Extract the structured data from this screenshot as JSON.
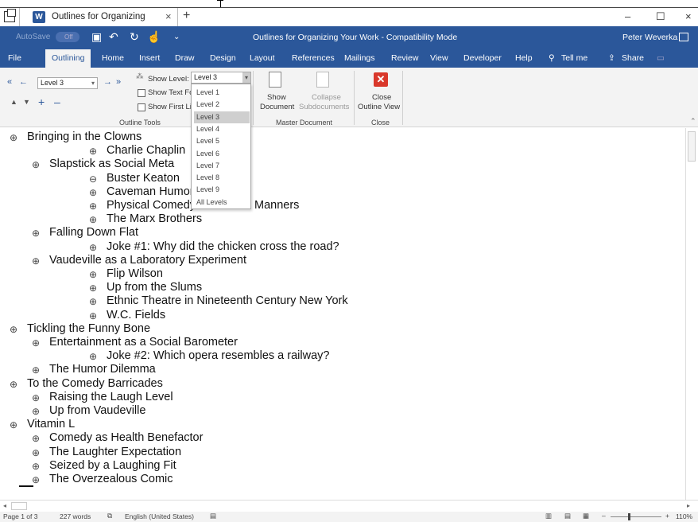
{
  "browser": {
    "tab_title": "Outlines for Organizing",
    "tab_close": "×",
    "new_tab": "+",
    "minimize": "–",
    "maximize": "☐",
    "close": "×"
  },
  "titlebar": {
    "autosave": "AutoSave",
    "autosave_state": "Off",
    "doc_title": "Outlines for Organizing Your Work - Compatibility Mode",
    "user": "Peter Weverka"
  },
  "ribbon_tabs": [
    "File",
    "Outlining",
    "Home",
    "Insert",
    "Draw",
    "Design",
    "Layout",
    "References",
    "Mailings",
    "Review",
    "View",
    "Developer",
    "Help",
    "Tell me",
    "Share"
  ],
  "ribbon": {
    "level_combo": "Level 3",
    "show_level_label": "Show Level:",
    "show_level_value": "Level 3",
    "show_text_formatting": "Show Text Fo",
    "show_first_line": "Show First Li",
    "outline_tools": "Outline Tools",
    "show_document": "Show",
    "show_document2": "Document",
    "collapse": "Collapse",
    "subdocuments": "Subdocuments",
    "master_document": "Master Document",
    "close_label": "Close",
    "close_outline": "Outline View",
    "close_group": "Close"
  },
  "dropdown_options": [
    "Level 1",
    "Level 2",
    "Level 3",
    "Level 4",
    "Level 5",
    "Level 6",
    "Level 7",
    "Level 8",
    "Level 9",
    "All Levels"
  ],
  "selected_option": "Level 3",
  "outline": [
    {
      "text": "Bringing in the Clowns",
      "level": 1,
      "sym": "⊕"
    },
    {
      "text": "Charlie Chaplin",
      "level": 3,
      "sym": "⊕"
    },
    {
      "text": "Slapstick as Social Meta",
      "level": 2,
      "sym": "⊕"
    },
    {
      "text": "Buster Keaton",
      "level": 3,
      "sym": "⊖"
    },
    {
      "text": "Caveman Humor",
      "level": 3,
      "sym": "⊕"
    },
    {
      "text": "Physical Comedy",
      "level": 3,
      "sym": "⊕",
      "suffix": "Manners"
    },
    {
      "text": "The Marx Brothers",
      "level": 3,
      "sym": "⊕"
    },
    {
      "text": "Falling Down Flat",
      "level": 2,
      "sym": "⊕"
    },
    {
      "text": "Joke #1: Why did the chicken cross the road?",
      "level": 3,
      "sym": "⊕"
    },
    {
      "text": "Vaudeville as a Laboratory Experiment",
      "level": 2,
      "sym": "⊕"
    },
    {
      "text": "Flip Wilson",
      "level": 3,
      "sym": "⊕"
    },
    {
      "text": "Up from the Slums",
      "level": 3,
      "sym": "⊕"
    },
    {
      "text": "Ethnic Theatre in Nineteenth Century New York",
      "level": 3,
      "sym": "⊕"
    },
    {
      "text": "W.C. Fields",
      "level": 3,
      "sym": "⊕"
    },
    {
      "text": "Tickling the Funny Bone",
      "level": 1,
      "sym": "⊕"
    },
    {
      "text": "Entertainment as a Social Barometer",
      "level": 2,
      "sym": "⊕"
    },
    {
      "text": "Joke #2: Which opera resembles a railway?",
      "level": 3,
      "sym": "⊕"
    },
    {
      "text": "The Humor Dilemma",
      "level": 2,
      "sym": "⊕"
    },
    {
      "text": "To the Comedy Barricades",
      "level": 1,
      "sym": "⊕"
    },
    {
      "text": "Raising the Laugh Level",
      "level": 2,
      "sym": "⊕"
    },
    {
      "text": "Up from Vaudeville",
      "level": 2,
      "sym": "⊕"
    },
    {
      "text": "Vitamin L",
      "level": 1,
      "sym": "⊕"
    },
    {
      "text": "Comedy as Health Benefactor",
      "level": 2,
      "sym": "⊕"
    },
    {
      "text": "The Laughter Expectation",
      "level": 2,
      "sym": "⊕"
    },
    {
      "text": "Seized by a Laughing Fit",
      "level": 2,
      "sym": "⊕"
    },
    {
      "text": "The Overzealous Comic",
      "level": 2,
      "sym": "⊕"
    }
  ],
  "status": {
    "page": "Page 1 of 3",
    "words": "227 words",
    "language": "English (United States)",
    "zoom": "110%"
  }
}
